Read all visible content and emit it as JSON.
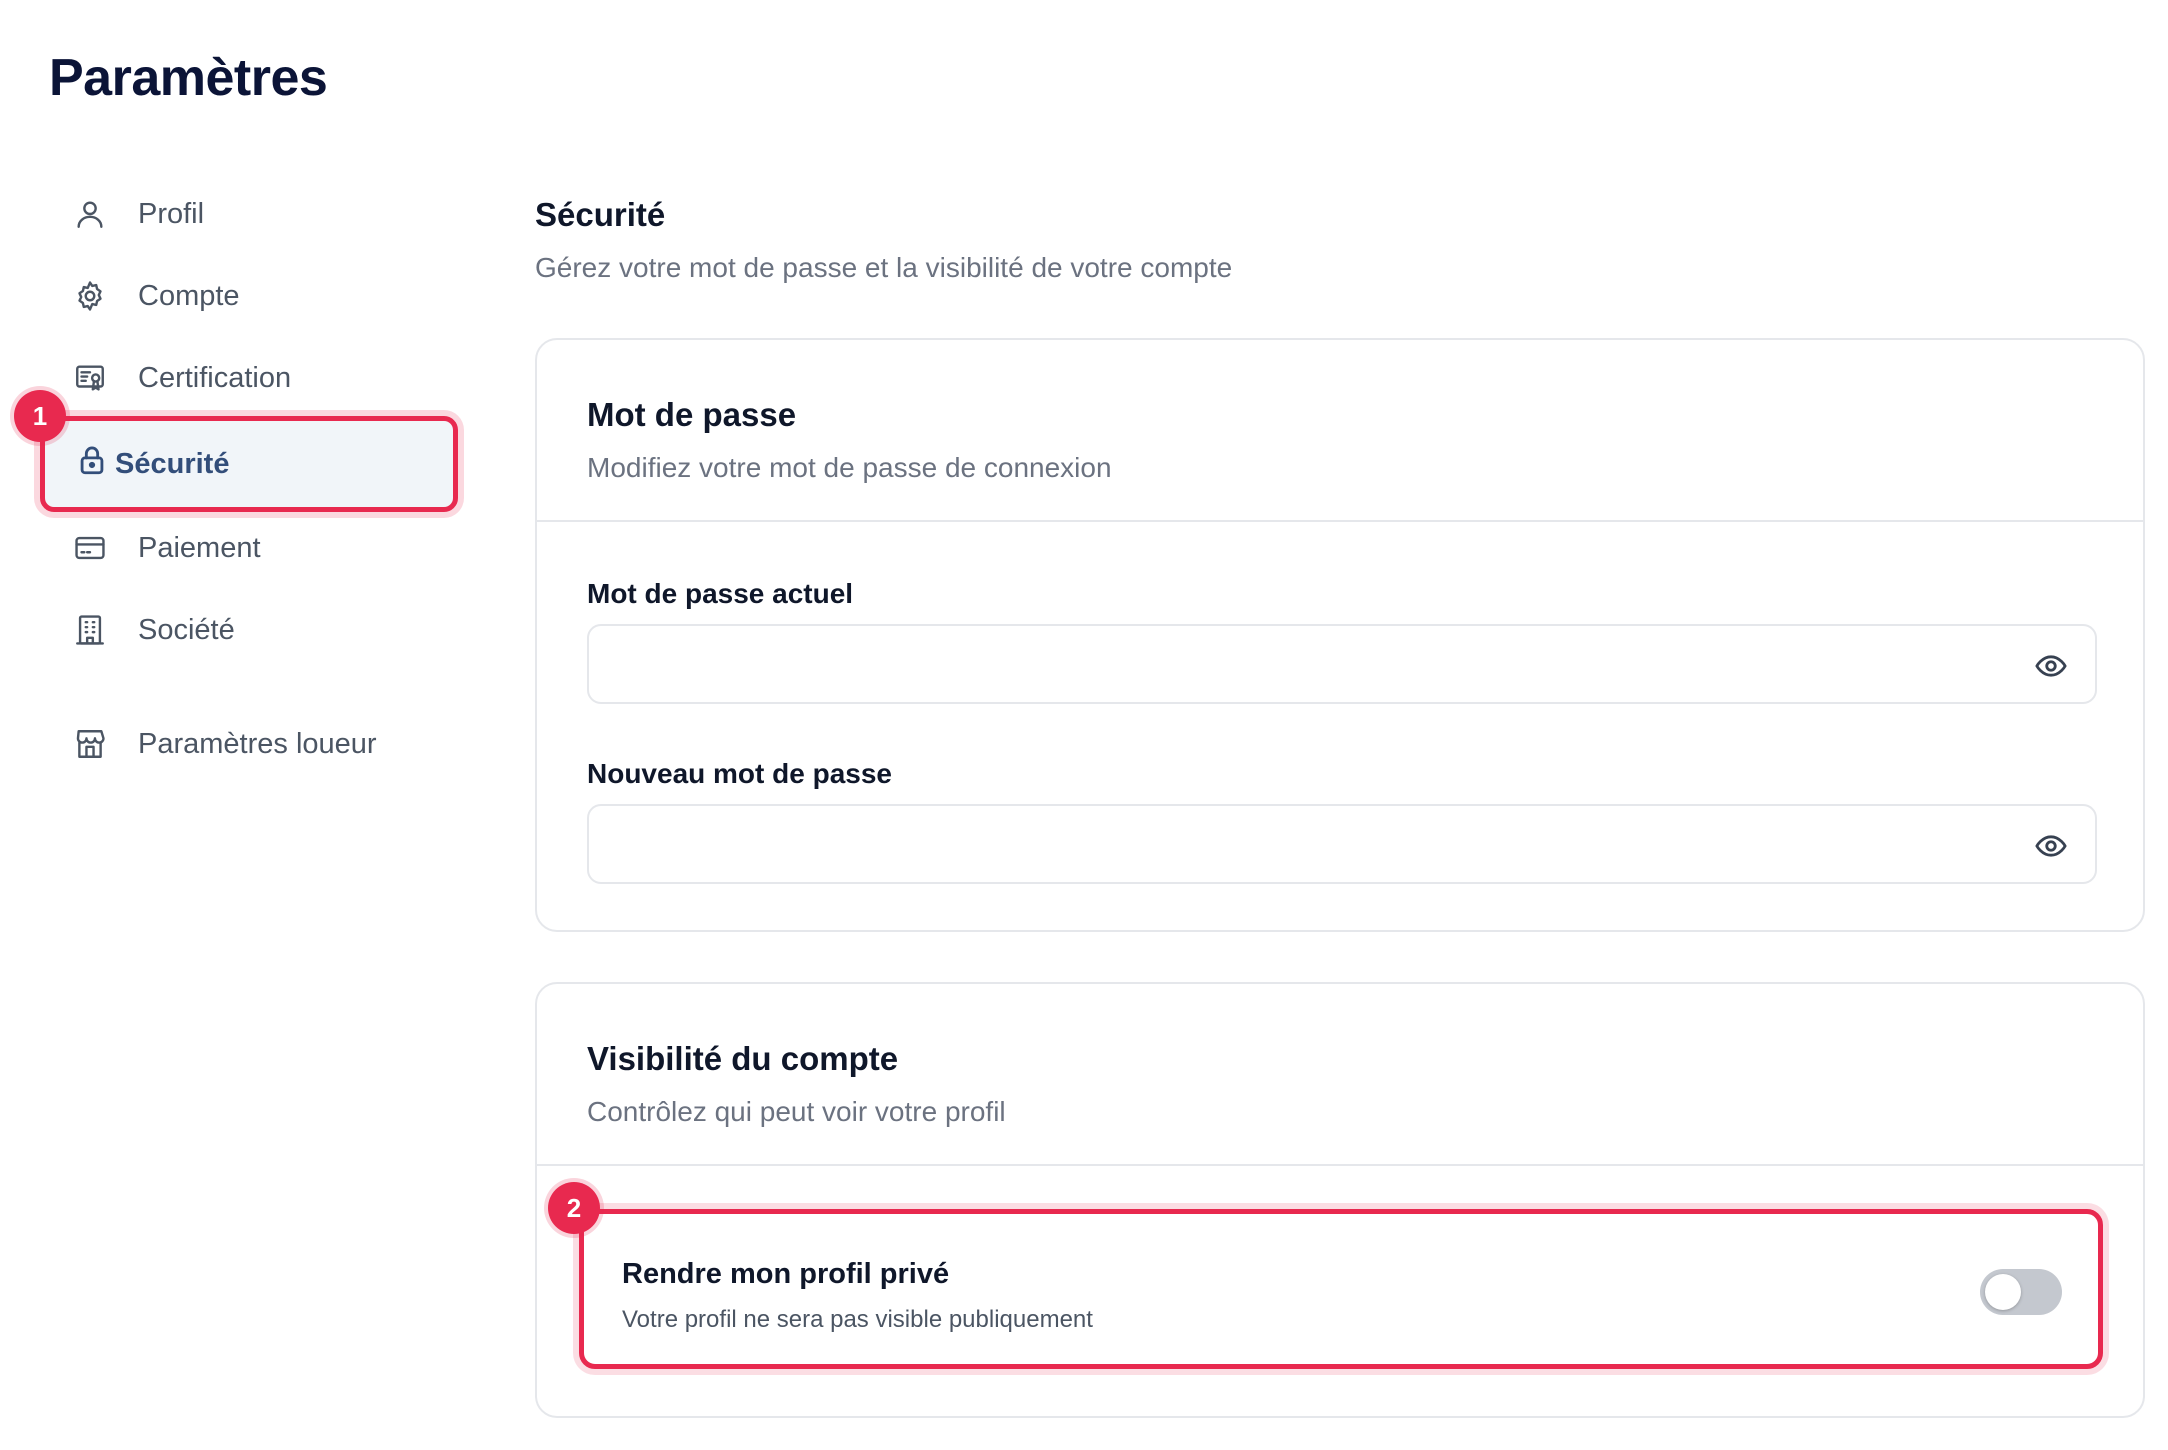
{
  "page": {
    "title": "Paramètres"
  },
  "sidebar": {
    "items": [
      {
        "label": "Profil",
        "icon": "user-icon"
      },
      {
        "label": "Compte",
        "icon": "gear-icon"
      },
      {
        "label": "Certification",
        "icon": "certificate-icon"
      },
      {
        "label": "Sécurité",
        "icon": "lock-icon",
        "active": true
      },
      {
        "label": "Paiement",
        "icon": "credit-card-icon"
      },
      {
        "label": "Société",
        "icon": "building-icon"
      },
      {
        "label": "Paramètres loueur",
        "icon": "store-icon"
      }
    ]
  },
  "annotations": {
    "badge_1": "1",
    "badge_2": "2",
    "highlight_color": "#e8294f"
  },
  "main": {
    "title": "Sécurité",
    "subtitle": "Gérez votre mot de passe et la visibilité de votre compte",
    "password_card": {
      "title": "Mot de passe",
      "subtitle": "Modifiez votre mot de passe de connexion",
      "current_label": "Mot de passe actuel",
      "current_value": "",
      "new_label": "Nouveau mot de passe",
      "new_value": ""
    },
    "visibility_card": {
      "title": "Visibilité du compte",
      "subtitle": "Contrôlez qui peut voir votre profil",
      "private_title": "Rendre mon profil privé",
      "private_sub": "Votre profil ne sera pas visible publiquement",
      "private_enabled": false
    }
  }
}
